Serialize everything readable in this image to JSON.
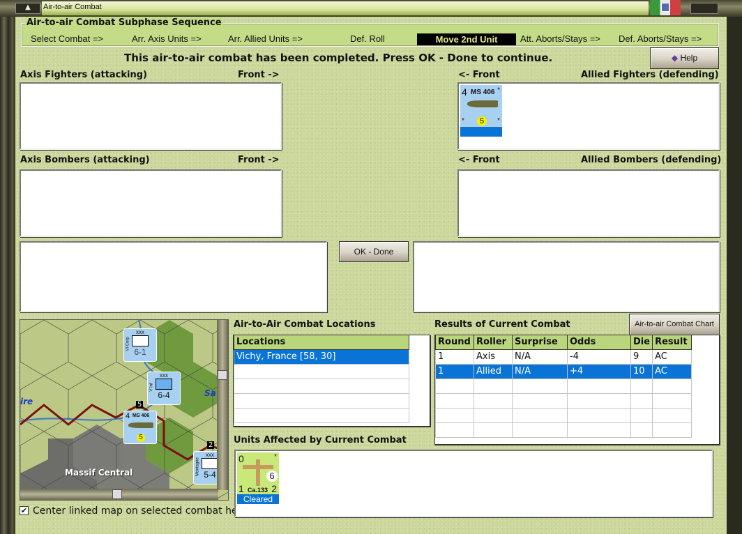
{
  "window": {
    "title": "Air-to-air Combat"
  },
  "sequence": {
    "title": "Air-to-air Combat Subphase Sequence",
    "steps": [
      "Select Combat =>",
      "Arr. Axis Units =>",
      "Arr. Allied Units =>",
      "Def. Roll",
      "Move 2nd Unit",
      "Att. Aborts/Stays =>",
      "Def. Aborts/Stays =>"
    ],
    "active_index": 4
  },
  "message": "This air-to-air combat has been completed.  Press OK - Done to continue.",
  "help_label": "Help",
  "panels": {
    "axis_fighters": "Axis Fighters (attacking)",
    "axis_fighters_front": "Front ->",
    "allied_fighters": "Allied Fighters (defending)",
    "allied_fighters_front": "<- Front",
    "axis_bombers": "Axis Bombers (attacking)",
    "axis_bombers_front": "Front ->",
    "allied_bombers": "Allied Bombers (defending)",
    "allied_bombers_front": "<- Front"
  },
  "allied_fighter_unit": {
    "attack": "4",
    "name": "MS 406",
    "defense": "5",
    "star": "*"
  },
  "ok_label": "OK - Done",
  "locations": {
    "title": "Air-to-Air Combat Locations",
    "header": "Locations",
    "rows": [
      "Vichy, France [58, 30]"
    ]
  },
  "results": {
    "title": "Results of Current Combat",
    "chart_button": "Air-to-air Combat Chart",
    "headers": [
      "Round",
      "Roller",
      "Surprise",
      "Odds",
      "Die",
      "Result"
    ],
    "rows": [
      [
        "1",
        "Axis",
        "N/A",
        "-4",
        "9",
        "AC"
      ],
      [
        "1",
        "Allied",
        "N/A",
        "+4",
        "10",
        "AC"
      ]
    ],
    "selected_row": 1
  },
  "affected": {
    "title": "Units Affected by Current Combat",
    "unit": {
      "top_left": "0",
      "star": "*",
      "defense": "6",
      "bottom_left": "1",
      "name": "Ca.133",
      "bottom_right": "2",
      "status": "Cleared"
    }
  },
  "map": {
    "label_massif": "Massif Central",
    "river_left": "ire",
    "river_right": "Sa",
    "units": [
      {
        "size": "xxx",
        "name": "VI Corp",
        "value": "6-1"
      },
      {
        "size": "xxx",
        "name": "V Inf",
        "value": "6-4"
      },
      {
        "size": "xxx",
        "name": "Montagne",
        "value": "5-4"
      }
    ],
    "fighter": {
      "attack": "4",
      "name": "MS 406",
      "defense": "5"
    },
    "stack_counts": [
      "5",
      "2"
    ]
  },
  "checkbox": {
    "label": "Center linked map on selected combat hex",
    "checked": true
  }
}
